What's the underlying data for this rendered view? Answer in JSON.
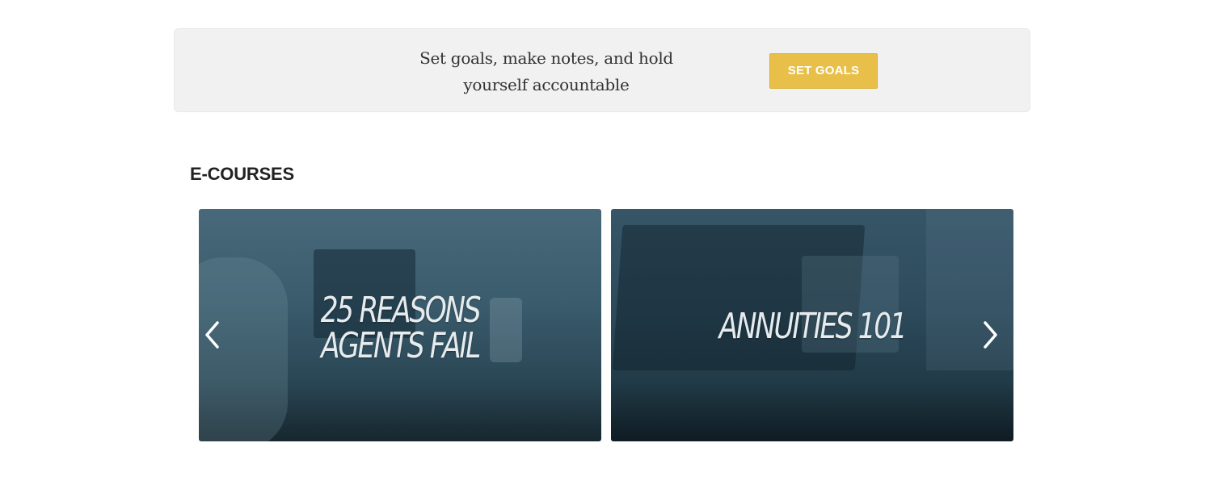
{
  "goals_banner": {
    "text": "Set goals, make notes, and hold yourself accountable",
    "button_label": "SET GOALS",
    "button_color": "#e8c049"
  },
  "ecourses": {
    "title": "E-COURSES",
    "cards": [
      {
        "title": "25 REASONS\nAGENTS FAIL"
      },
      {
        "title": "ANNUITIES 101"
      }
    ],
    "prev_icon": "chevron-left-icon",
    "next_icon": "chevron-right-icon"
  }
}
